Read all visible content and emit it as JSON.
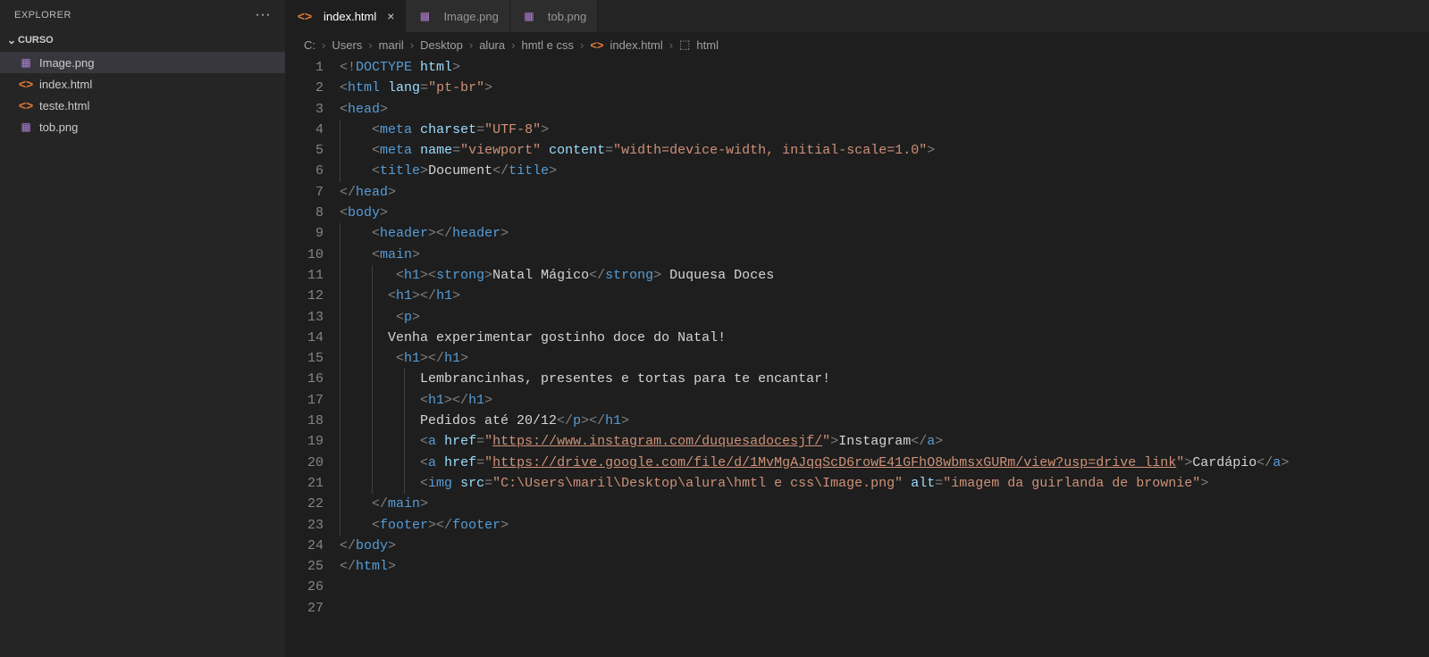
{
  "explorer": {
    "title": "EXPLORER",
    "folder": "CURSO",
    "files": [
      {
        "name": "Image.png",
        "icon": "img",
        "selected": true
      },
      {
        "name": "index.html",
        "icon": "html",
        "selected": false
      },
      {
        "name": "teste.html",
        "icon": "html",
        "selected": false
      },
      {
        "name": "tob.png",
        "icon": "img",
        "selected": false
      }
    ]
  },
  "tabs": [
    {
      "label": "index.html",
      "icon": "html",
      "active": true,
      "close": true
    },
    {
      "label": "Image.png",
      "icon": "img",
      "active": false,
      "close": false
    },
    {
      "label": "tob.png",
      "icon": "img",
      "active": false,
      "close": false
    }
  ],
  "breadcrumbs": [
    "C:",
    "Users",
    "maril",
    "Desktop",
    "alura",
    "hmtl e css",
    "index.html",
    "html"
  ],
  "breadcrumbs_icons": {
    "6": "html",
    "7": "symbol"
  },
  "code": {
    "title_text": "Document",
    "h1_strong": "Natal Mágico",
    "h1_rest": " Duquesa Doces",
    "p_line1": "Venha experimentar gostinho doce do Natal!",
    "p_line2": "Lembrancinhas, presentes e tortas para te encantar!",
    "p_line3": "Pedidos até 20/12",
    "a1_href": "https://www.instagram.com/duquesadocesjf/",
    "a1_text": "Instagram",
    "a2_href": "https://drive.google.com/file/d/1MvMgAJqqScD6rowE41GFhO8wbmsxGURm/view?usp=drive_link",
    "a2_text": "Cardápio",
    "img_src": "C:\\Users\\maril\\Desktop\\alura\\hmtl e css\\Image.png",
    "img_alt": "imagem da guirlanda de brownie",
    "lang": "pt-br",
    "charset": "UTF-8",
    "viewport": "width=device-width, initial-scale=1.0"
  },
  "line_count": 27
}
